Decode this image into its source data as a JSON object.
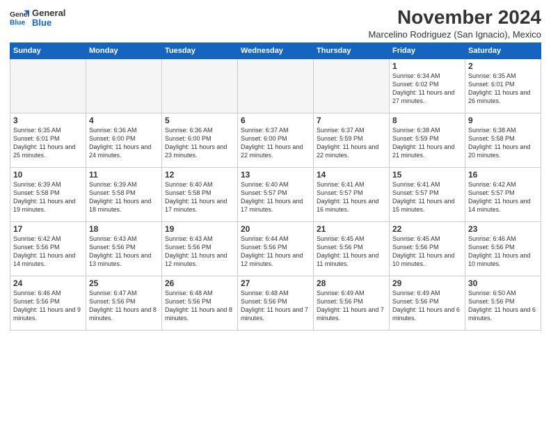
{
  "header": {
    "logo_line1": "General",
    "logo_line2": "Blue",
    "month_title": "November 2024",
    "location": "Marcelino Rodriguez (San Ignacio), Mexico"
  },
  "weekdays": [
    "Sunday",
    "Monday",
    "Tuesday",
    "Wednesday",
    "Thursday",
    "Friday",
    "Saturday"
  ],
  "weeks": [
    [
      {
        "day": "",
        "info": ""
      },
      {
        "day": "",
        "info": ""
      },
      {
        "day": "",
        "info": ""
      },
      {
        "day": "",
        "info": ""
      },
      {
        "day": "",
        "info": ""
      },
      {
        "day": "1",
        "info": "Sunrise: 6:34 AM\nSunset: 6:02 PM\nDaylight: 11 hours and 27 minutes."
      },
      {
        "day": "2",
        "info": "Sunrise: 6:35 AM\nSunset: 6:01 PM\nDaylight: 11 hours and 26 minutes."
      }
    ],
    [
      {
        "day": "3",
        "info": "Sunrise: 6:35 AM\nSunset: 6:01 PM\nDaylight: 11 hours and 25 minutes."
      },
      {
        "day": "4",
        "info": "Sunrise: 6:36 AM\nSunset: 6:00 PM\nDaylight: 11 hours and 24 minutes."
      },
      {
        "day": "5",
        "info": "Sunrise: 6:36 AM\nSunset: 6:00 PM\nDaylight: 11 hours and 23 minutes."
      },
      {
        "day": "6",
        "info": "Sunrise: 6:37 AM\nSunset: 6:00 PM\nDaylight: 11 hours and 22 minutes."
      },
      {
        "day": "7",
        "info": "Sunrise: 6:37 AM\nSunset: 5:59 PM\nDaylight: 11 hours and 22 minutes."
      },
      {
        "day": "8",
        "info": "Sunrise: 6:38 AM\nSunset: 5:59 PM\nDaylight: 11 hours and 21 minutes."
      },
      {
        "day": "9",
        "info": "Sunrise: 6:38 AM\nSunset: 5:58 PM\nDaylight: 11 hours and 20 minutes."
      }
    ],
    [
      {
        "day": "10",
        "info": "Sunrise: 6:39 AM\nSunset: 5:58 PM\nDaylight: 11 hours and 19 minutes."
      },
      {
        "day": "11",
        "info": "Sunrise: 6:39 AM\nSunset: 5:58 PM\nDaylight: 11 hours and 18 minutes."
      },
      {
        "day": "12",
        "info": "Sunrise: 6:40 AM\nSunset: 5:58 PM\nDaylight: 11 hours and 17 minutes."
      },
      {
        "day": "13",
        "info": "Sunrise: 6:40 AM\nSunset: 5:57 PM\nDaylight: 11 hours and 17 minutes."
      },
      {
        "day": "14",
        "info": "Sunrise: 6:41 AM\nSunset: 5:57 PM\nDaylight: 11 hours and 16 minutes."
      },
      {
        "day": "15",
        "info": "Sunrise: 6:41 AM\nSunset: 5:57 PM\nDaylight: 11 hours and 15 minutes."
      },
      {
        "day": "16",
        "info": "Sunrise: 6:42 AM\nSunset: 5:57 PM\nDaylight: 11 hours and 14 minutes."
      }
    ],
    [
      {
        "day": "17",
        "info": "Sunrise: 6:42 AM\nSunset: 5:56 PM\nDaylight: 11 hours and 14 minutes."
      },
      {
        "day": "18",
        "info": "Sunrise: 6:43 AM\nSunset: 5:56 PM\nDaylight: 11 hours and 13 minutes."
      },
      {
        "day": "19",
        "info": "Sunrise: 6:43 AM\nSunset: 5:56 PM\nDaylight: 11 hours and 12 minutes."
      },
      {
        "day": "20",
        "info": "Sunrise: 6:44 AM\nSunset: 5:56 PM\nDaylight: 11 hours and 12 minutes."
      },
      {
        "day": "21",
        "info": "Sunrise: 6:45 AM\nSunset: 5:56 PM\nDaylight: 11 hours and 11 minutes."
      },
      {
        "day": "22",
        "info": "Sunrise: 6:45 AM\nSunset: 5:56 PM\nDaylight: 11 hours and 10 minutes."
      },
      {
        "day": "23",
        "info": "Sunrise: 6:46 AM\nSunset: 5:56 PM\nDaylight: 11 hours and 10 minutes."
      }
    ],
    [
      {
        "day": "24",
        "info": "Sunrise: 6:46 AM\nSunset: 5:56 PM\nDaylight: 11 hours and 9 minutes."
      },
      {
        "day": "25",
        "info": "Sunrise: 6:47 AM\nSunset: 5:56 PM\nDaylight: 11 hours and 8 minutes."
      },
      {
        "day": "26",
        "info": "Sunrise: 6:48 AM\nSunset: 5:56 PM\nDaylight: 11 hours and 8 minutes."
      },
      {
        "day": "27",
        "info": "Sunrise: 6:48 AM\nSunset: 5:56 PM\nDaylight: 11 hours and 7 minutes."
      },
      {
        "day": "28",
        "info": "Sunrise: 6:49 AM\nSunset: 5:56 PM\nDaylight: 11 hours and 7 minutes."
      },
      {
        "day": "29",
        "info": "Sunrise: 6:49 AM\nSunset: 5:56 PM\nDaylight: 11 hours and 6 minutes."
      },
      {
        "day": "30",
        "info": "Sunrise: 6:50 AM\nSunset: 5:56 PM\nDaylight: 11 hours and 6 minutes."
      }
    ]
  ]
}
